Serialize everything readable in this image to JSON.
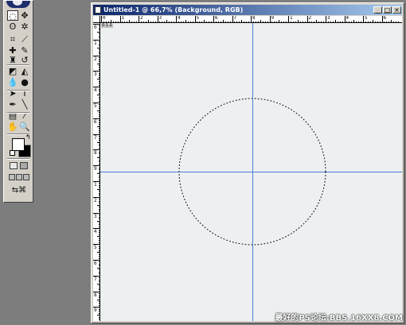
{
  "document": {
    "title": "Untitled-1 @ 66,7% (Background, RGB)",
    "canvas_color": "#edf0f1",
    "guide_color": "#4a7bd8",
    "window_buttons": {
      "minimize": "_",
      "maximize": "□",
      "close": "×"
    }
  },
  "rulers": {
    "horizontal_labels": [
      "0",
      "1",
      "2",
      "3",
      "4",
      "5",
      "6",
      "7",
      "8",
      "9",
      "1",
      "2",
      "3",
      "4",
      "5",
      "6"
    ],
    "vertical_labels": [
      "0",
      "1",
      "2",
      "3",
      "4",
      "5",
      "6",
      "7",
      "8",
      "9",
      "1",
      "2",
      "3",
      "4",
      "5",
      "6",
      "7",
      "8",
      "9"
    ],
    "position_readout": "0 1 2"
  },
  "toolbox": {
    "tools": [
      {
        "name": "marquee-tool-icon",
        "glyph": "◌",
        "active": true
      },
      {
        "name": "move-tool-icon",
        "glyph": "✥",
        "active": false
      },
      {
        "name": "lasso-tool-icon",
        "glyph": "ʘ",
        "active": false
      },
      {
        "name": "magic-wand-tool-icon",
        "glyph": "✲",
        "active": false
      },
      {
        "name": "crop-tool-icon",
        "glyph": "⌗",
        "active": false
      },
      {
        "name": "slice-tool-icon",
        "glyph": "⟋",
        "active": false
      },
      {
        "name": "healing-brush-tool-icon",
        "glyph": "✚",
        "active": false
      },
      {
        "name": "brush-tool-icon",
        "glyph": "✎",
        "active": false
      },
      {
        "name": "clone-stamp-tool-icon",
        "glyph": "♜",
        "active": false
      },
      {
        "name": "history-brush-tool-icon",
        "glyph": "↺",
        "active": false
      },
      {
        "name": "eraser-tool-icon",
        "glyph": "◩",
        "active": false
      },
      {
        "name": "paint-bucket-tool-icon",
        "glyph": "◭",
        "active": false
      },
      {
        "name": "blur-tool-icon",
        "glyph": "💧",
        "active": false
      },
      {
        "name": "dodge-tool-icon",
        "glyph": "●",
        "active": false
      },
      {
        "name": "path-selection-tool-icon",
        "glyph": "➤",
        "active": false
      },
      {
        "name": "type-tool-icon",
        "glyph": "T",
        "active": false
      },
      {
        "name": "pen-tool-icon",
        "glyph": "✒",
        "active": false
      },
      {
        "name": "line-tool-icon",
        "glyph": "╲",
        "active": false
      },
      {
        "name": "notes-tool-icon",
        "glyph": "▤",
        "active": false
      },
      {
        "name": "eyedropper-tool-icon",
        "glyph": "⁄",
        "active": false
      },
      {
        "name": "hand-tool-icon",
        "glyph": "✋",
        "active": false
      },
      {
        "name": "zoom-tool-icon",
        "glyph": "🔍",
        "active": false
      }
    ],
    "foreground_color": "#ffffff",
    "background_color": "#000000"
  },
  "watermark": "最好的PS论坛:BBS.16XX8.COM"
}
